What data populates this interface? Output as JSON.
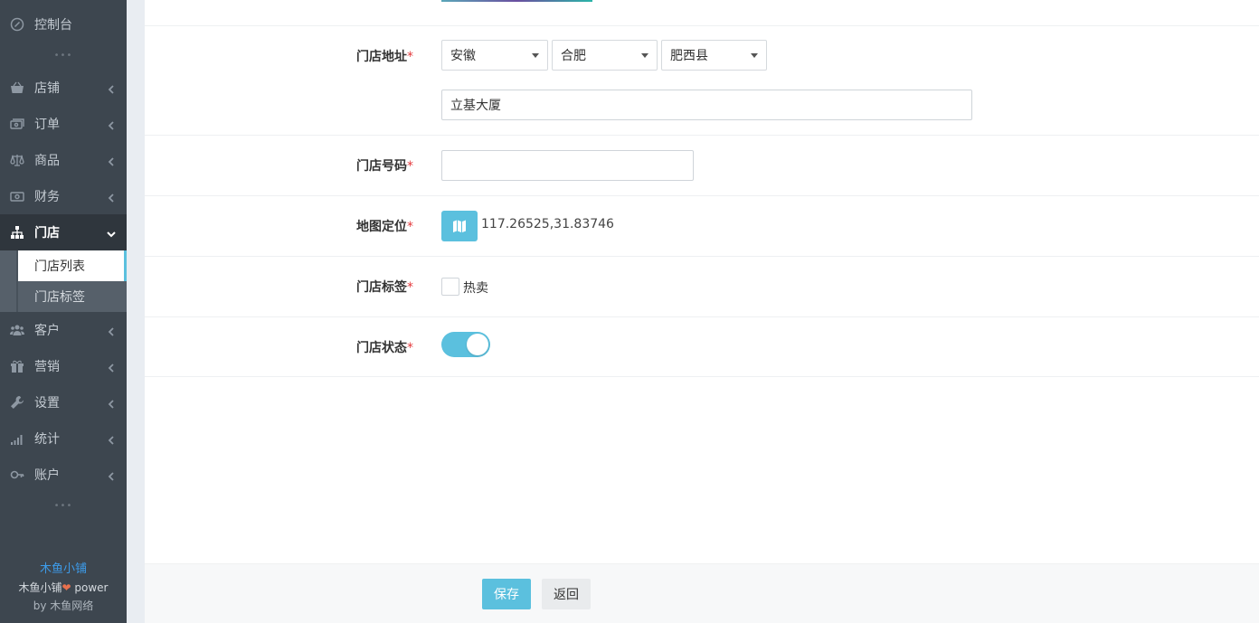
{
  "sidebar": {
    "dashboard": "控制台",
    "dots": "•••",
    "items": [
      {
        "label": "店铺",
        "icon": "basket-icon"
      },
      {
        "label": "订单",
        "icon": "money-stack-icon"
      },
      {
        "label": "商品",
        "icon": "scale-icon"
      },
      {
        "label": "财务",
        "icon": "banknote-icon"
      },
      {
        "label": "门店",
        "icon": "sitemap-icon"
      },
      {
        "label": "客户",
        "icon": "users-icon"
      },
      {
        "label": "营销",
        "icon": "gift-icon"
      },
      {
        "label": "设置",
        "icon": "wrench-icon"
      },
      {
        "label": "统计",
        "icon": "signal-bars-icon"
      },
      {
        "label": "账户",
        "icon": "key-icon"
      }
    ],
    "sub_items": [
      "门店列表",
      "门店标签"
    ],
    "brand_name": "木鱼小铺",
    "power_prefix": "木鱼小铺",
    "power_suffix": " power",
    "by_prefix": "by ",
    "by_name": "木鱼网络"
  },
  "form": {
    "address": {
      "label": "门店地址",
      "province": "安徽",
      "city": "合肥",
      "district": "肥西县",
      "detail": "立基大厦"
    },
    "phone": {
      "label": "门店号码",
      "value": ""
    },
    "map": {
      "label": "地图定位",
      "coords": "117.26525,31.83746"
    },
    "tag": {
      "label": "门店标签",
      "option": "热卖",
      "checked": false
    },
    "status": {
      "label": "门店状态",
      "on": true
    },
    "required_mark": "*"
  },
  "footer": {
    "save": "保存",
    "back": "返回"
  },
  "colors": {
    "accent": "#5bc0de",
    "sidebar_bg": "#3d464f",
    "required": "#e4393c"
  }
}
